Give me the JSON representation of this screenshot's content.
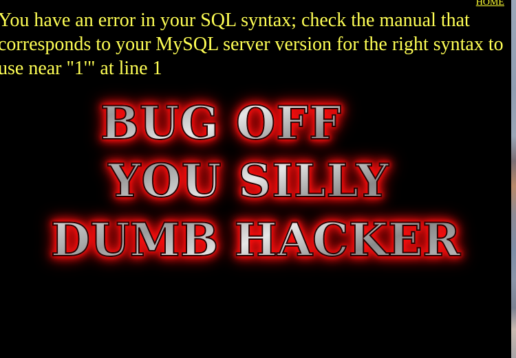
{
  "nav": {
    "home_label": "HOME"
  },
  "error": {
    "message": "You have an error in your SQL syntax; check the manual that corresponds to your MySQL server version for the right syntax to use near \"1'\" at line 1"
  },
  "banner": {
    "lines": [
      "BUG OFF",
      "YOU SILLY",
      "DUMB HACKER"
    ]
  },
  "colors": {
    "background": "#000000",
    "error_text": "#ffff55",
    "link": "#ffff33",
    "banner_glow": "#ff0000",
    "banner_metal": "#c8c8c8"
  }
}
